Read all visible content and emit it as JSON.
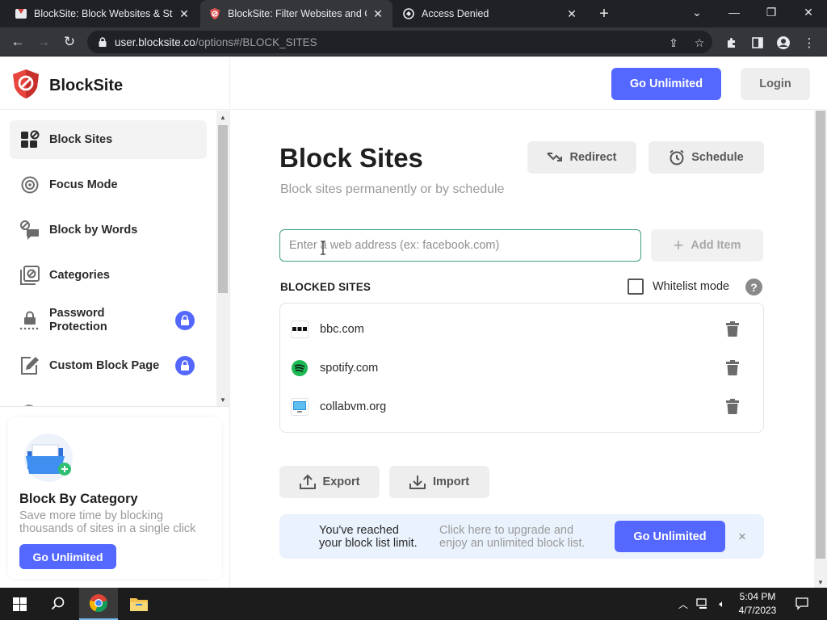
{
  "browser": {
    "tabs": [
      {
        "title": "BlockSite: Block Websites & Stay"
      },
      {
        "title": "BlockSite: Filter Websites and Co"
      },
      {
        "title": "Access Denied"
      }
    ],
    "url_host": "user.blocksite.co",
    "url_path": "/options#/BLOCK_SITES"
  },
  "header": {
    "brand": "BlockSite",
    "go_unlimited": "Go Unlimited",
    "login": "Login"
  },
  "sidebar": {
    "items": [
      {
        "label": "Block Sites",
        "icon": "grid-block-icon"
      },
      {
        "label": "Focus Mode",
        "icon": "target-icon"
      },
      {
        "label": "Block by Words",
        "icon": "speech-block-icon"
      },
      {
        "label": "Categories",
        "icon": "categories-icon"
      },
      {
        "label": "Password Protection",
        "icon": "password-icon",
        "locked": true
      },
      {
        "label": "Custom Block Page",
        "icon": "edit-page-icon",
        "locked": true
      }
    ],
    "promo": {
      "title": "Block By Category",
      "description": "Save more time by blocking thousands of sites in a single click",
      "button": "Go Unlimited"
    }
  },
  "main": {
    "title": "Block Sites",
    "subtitle": "Block sites permanently or by schedule",
    "redirect": "Redirect",
    "schedule": "Schedule",
    "input_placeholder": "Enter a web address (ex: facebook.com)",
    "add_item": "Add Item",
    "section_title": "BLOCKED SITES",
    "whitelist_label": "Whitelist mode",
    "whitelist_checked": false,
    "help": "?",
    "blocked_sites": [
      {
        "domain": "bbc.com"
      },
      {
        "domain": "spotify.com"
      },
      {
        "domain": "collabvm.org"
      }
    ],
    "export": "Export",
    "import": "Import",
    "banner": {
      "left_line1": "You've reached",
      "left_line2": "your block list limit.",
      "mid_line1": "Click here to upgrade and",
      "mid_line2": "enjoy an unlimited block list.",
      "button": "Go Unlimited",
      "close": "×"
    }
  },
  "taskbar": {
    "time": "5:04 PM",
    "date": "4/7/2023"
  },
  "colors": {
    "accent": "#5468ff",
    "input_focus": "#3f9f7f",
    "banner_bg": "#eaf2fd"
  }
}
